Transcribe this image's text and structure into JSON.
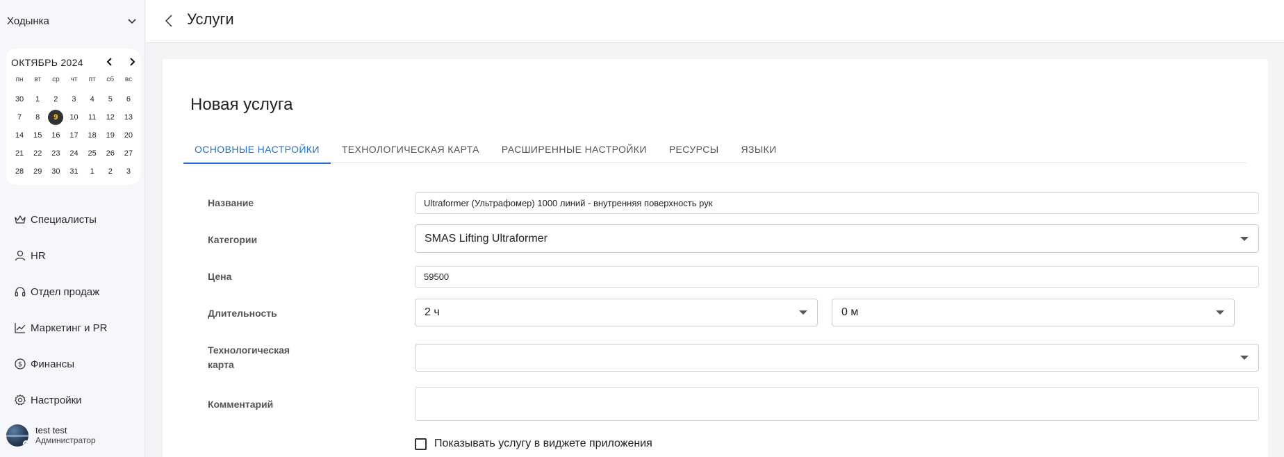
{
  "sidebar": {
    "location": "Ходынка",
    "calendar": {
      "month_label": "ОКТЯБРЬ 2024",
      "weekdays": [
        "пн",
        "вт",
        "ср",
        "чт",
        "пт",
        "сб",
        "вс"
      ],
      "weeks": [
        [
          "30",
          "1",
          "2",
          "3",
          "4",
          "5",
          "6"
        ],
        [
          "7",
          "8",
          "9",
          "10",
          "11",
          "12",
          "13"
        ],
        [
          "14",
          "15",
          "16",
          "17",
          "18",
          "19",
          "20"
        ],
        [
          "21",
          "22",
          "23",
          "24",
          "25",
          "26",
          "27"
        ],
        [
          "28",
          "29",
          "30",
          "31",
          "1",
          "2",
          "3"
        ]
      ],
      "today": "9"
    },
    "nav": [
      {
        "label": "Специалисты",
        "icon": "crown-icon"
      },
      {
        "label": "HR",
        "icon": "user-icon"
      },
      {
        "label": "Отдел продаж",
        "icon": "headset-icon"
      },
      {
        "label": "Маркетинг и PR",
        "icon": "chart-line-icon"
      },
      {
        "label": "Финансы",
        "icon": "dollar-circle-icon"
      },
      {
        "label": "Настройки",
        "icon": "gear-icon"
      }
    ],
    "user": {
      "name": "test test",
      "role": "Администратор",
      "status_color": "#2ecc71"
    }
  },
  "header": {
    "title": "Услуги"
  },
  "form": {
    "title": "Новая услуга",
    "tabs": [
      {
        "label": "ОСНОВНЫЕ НАСТРОЙКИ",
        "active": true
      },
      {
        "label": "ТЕХНОЛОГИЧЕСКАЯ КАРТА",
        "active": false
      },
      {
        "label": "РАСШИРЕННЫЕ НАСТРОЙКИ",
        "active": false
      },
      {
        "label": "РЕСУРСЫ",
        "active": false
      },
      {
        "label": "ЯЗЫКИ",
        "active": false
      }
    ],
    "fields": {
      "name_label": "Название",
      "name_value": "Ultraformer (Ультрафомер) 1000 линий - внутренняя поверхность рук",
      "category_label": "Категории",
      "category_value": "SMAS Lifting Ultraformer",
      "price_label": "Цена",
      "price_value": "59500",
      "duration_label": "Длительность",
      "duration_hours": "2 ч",
      "duration_minutes": "0 м",
      "techcard_label_line1": "Технологическая",
      "techcard_label_line2": "карта",
      "techcard_value": "",
      "comment_label": "Комментарий",
      "comment_value": ""
    },
    "checkbox_label": "Показывать услугу в виджете приложения",
    "checkbox_checked": false
  },
  "colors": {
    "accent": "#1e6fcf",
    "today_bg": "#333333",
    "today_text": "#ffcc33"
  }
}
